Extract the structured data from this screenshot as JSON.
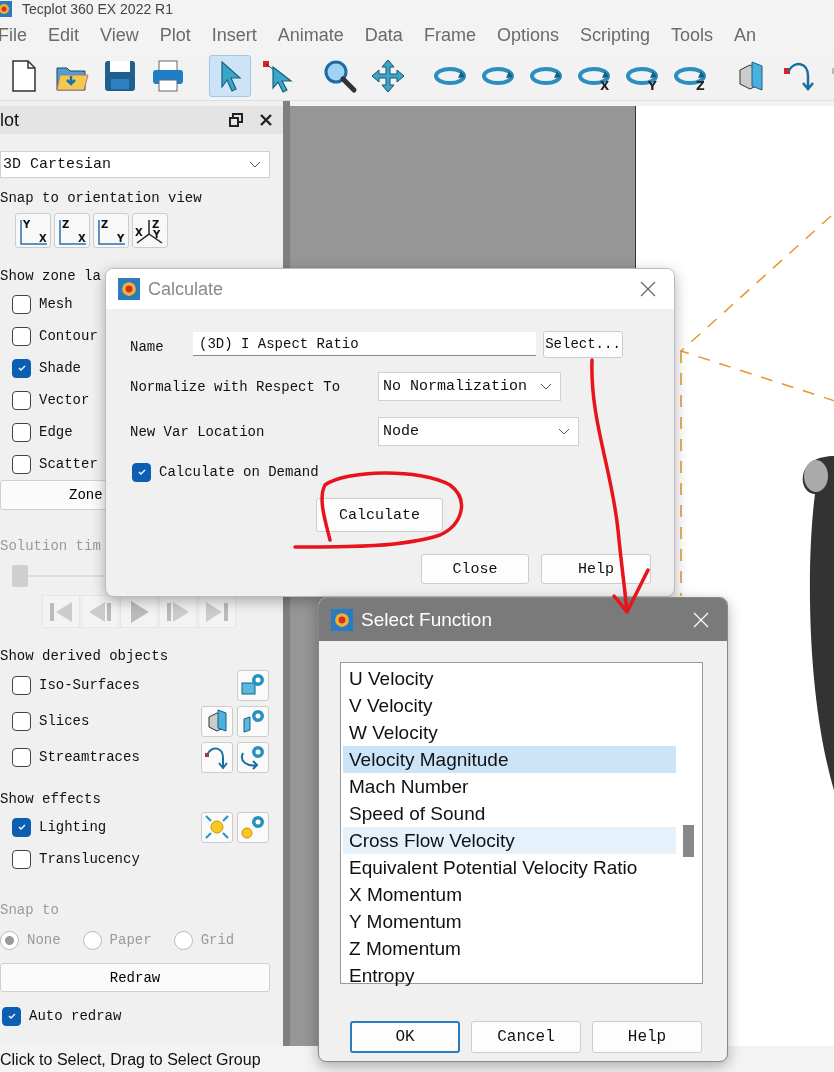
{
  "app_title": "Tecplot 360 EX 2022 R1",
  "menu": [
    "File",
    "Edit",
    "View",
    "Plot",
    "Insert",
    "Animate",
    "Data",
    "Frame",
    "Options",
    "Scripting",
    "Tools",
    "An"
  ],
  "toolbar": [
    {
      "kind": "newfile",
      "selected": false
    },
    {
      "kind": "open",
      "selected": false
    },
    {
      "kind": "save",
      "selected": false
    },
    {
      "kind": "print",
      "selected": false
    },
    {
      "kind": "sep"
    },
    {
      "kind": "select",
      "selected": true
    },
    {
      "kind": "adjust",
      "selected": false
    },
    {
      "kind": "sep"
    },
    {
      "kind": "zoom",
      "selected": false
    },
    {
      "kind": "translate",
      "selected": false
    },
    {
      "kind": "sep"
    },
    {
      "kind": "spherical",
      "selected": false
    },
    {
      "kind": "rollerball",
      "selected": false
    },
    {
      "kind": "twist",
      "selected": false
    },
    {
      "kind": "rotx",
      "letter": "X",
      "selected": false
    },
    {
      "kind": "roty",
      "letter": "Y",
      "selected": false
    },
    {
      "kind": "rotz",
      "letter": "Z",
      "selected": false
    },
    {
      "kind": "sep"
    },
    {
      "kind": "slice",
      "selected": false
    },
    {
      "kind": "stream",
      "selected": false
    },
    {
      "kind": "streamdim",
      "selected": false
    }
  ],
  "plot_panel": {
    "title": "lot",
    "plot_type": "3D Cartesian",
    "snap_view_label": "Snap to orientation view",
    "view_buttons": [
      {
        "kind": "plane",
        "top": "Y",
        "right": "X"
      },
      {
        "kind": "plane",
        "top": "Z",
        "right": "X"
      },
      {
        "kind": "plane",
        "top": "Z",
        "right": "Y"
      },
      {
        "kind": "iso",
        "left": "X",
        "top": "Z",
        "right": "Y"
      }
    ],
    "zone_layers": {
      "label": "Show zone la",
      "items": [
        {
          "label": "Mesh",
          "checked": false
        },
        {
          "label": "Contour",
          "checked": false
        },
        {
          "label": "Shade",
          "checked": true
        },
        {
          "label": "Vector",
          "checked": false
        },
        {
          "label": "Edge",
          "checked": false
        },
        {
          "label": "Scatter",
          "checked": false
        }
      ]
    },
    "zone_button": "Zone",
    "solution_time": {
      "label": "Solution tim",
      "level": 0
    },
    "derived": {
      "label": "Show derived objects",
      "items": [
        {
          "label": "Iso-Surfaces",
          "checked": false,
          "tools": [
            {
              "kind": "isosettings"
            }
          ]
        },
        {
          "label": "Slices",
          "checked": false,
          "tools": [
            {
              "kind": "slice"
            },
            {
              "kind": "slicesettings"
            }
          ]
        },
        {
          "label": "Streamtraces",
          "checked": false,
          "tools": [
            {
              "kind": "stream"
            },
            {
              "kind": "streamsettings"
            }
          ]
        }
      ]
    },
    "effects": {
      "label": "Show effects",
      "items": [
        {
          "label": "Lighting",
          "checked": true,
          "tools": [
            {
              "kind": "light"
            },
            {
              "kind": "lightsettings"
            }
          ]
        },
        {
          "label": "Translucency",
          "checked": false
        }
      ]
    },
    "snap_to": {
      "label": "Snap to",
      "disabled": true,
      "options": [
        {
          "label": "None",
          "selected": true
        },
        {
          "label": "Paper",
          "selected": false
        },
        {
          "label": "Grid",
          "selected": false
        }
      ]
    },
    "redraw_button": "Redraw",
    "auto_redraw": {
      "label": "Auto redraw",
      "checked": true
    }
  },
  "status_bar": "Click to Select, Drag to Select Group",
  "calculate_dialog": {
    "title": "Calculate",
    "name_label": "Name",
    "name_value": "(3D) I Aspect Ratio",
    "select_button": "Select...",
    "normalize_label": "Normalize with Respect To",
    "normalize_value": "No Normalization",
    "location_label": "New Var Location",
    "location_value": "Node",
    "on_demand": {
      "label": "Calculate on Demand",
      "checked": true
    },
    "calculate_button": "Calculate",
    "close_button": "Close",
    "help_button": "Help"
  },
  "select_function_dialog": {
    "title": "Select Function",
    "items": [
      {
        "label": "U Velocity",
        "selected": false,
        "hovered": false
      },
      {
        "label": "V Velocity",
        "selected": false,
        "hovered": false
      },
      {
        "label": "W Velocity",
        "selected": false,
        "hovered": false
      },
      {
        "label": "Velocity Magnitude",
        "selected": true,
        "hovered": false
      },
      {
        "label": "Mach Number",
        "selected": false,
        "hovered": false
      },
      {
        "label": "Speed of Sound",
        "selected": false,
        "hovered": false
      },
      {
        "label": "Cross Flow Velocity",
        "selected": false,
        "hovered": true
      },
      {
        "label": "Equivalent Potential Velocity Ratio",
        "selected": false,
        "hovered": false
      },
      {
        "label": "X Momentum",
        "selected": false,
        "hovered": false
      },
      {
        "label": "Y Momentum",
        "selected": false,
        "hovered": false
      },
      {
        "label": "Z Momentum",
        "selected": false,
        "hovered": false
      },
      {
        "label": "Entropy",
        "selected": false,
        "hovered": false
      }
    ],
    "ok_button": "OK",
    "cancel_button": "Cancel",
    "help_button": "Help"
  }
}
